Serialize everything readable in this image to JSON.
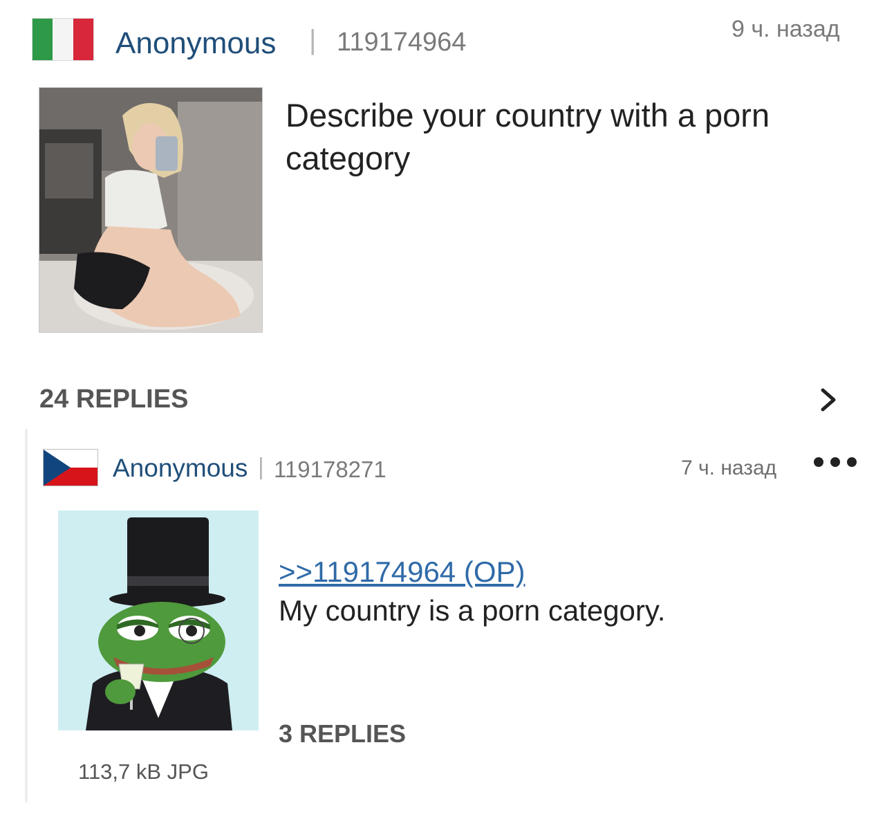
{
  "op": {
    "flag_colors": [
      "#2e9a48",
      "#f4f4f4",
      "#d8263a"
    ],
    "author": "Anonymous",
    "separator": "|",
    "post_number": "119174964",
    "time": "9 ч. назад",
    "subject": "Describe your country with a porn category",
    "replies_label": "24 REPLIES",
    "chevron_icon": "chevron-right-icon"
  },
  "reply": {
    "flag_colors": [
      "#ffffff",
      "#d7141a",
      "#11457e"
    ],
    "author": "Anonymous",
    "separator": "|",
    "post_number": "119178271",
    "time": "7 ч. назад",
    "more_icon": "more-dots-icon",
    "quote_link": ">>119174964 (OP)",
    "text": "My country is a porn category.",
    "replies_label": "3 REPLIES",
    "file_info": "113,7 kB JPG"
  }
}
